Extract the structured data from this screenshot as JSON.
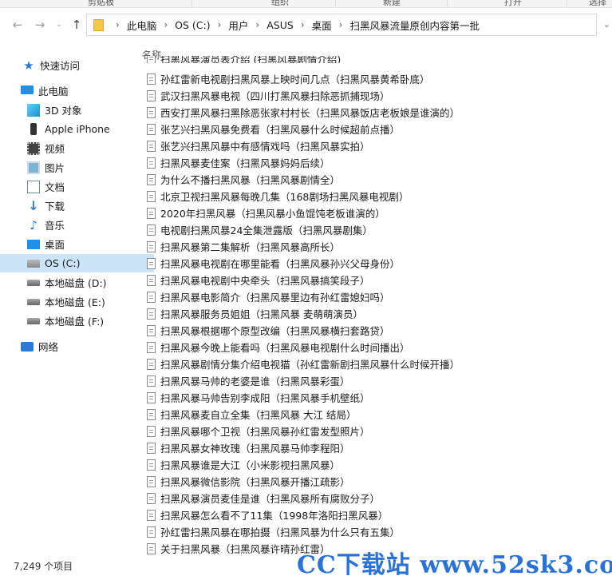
{
  "ribbon": {
    "tabs": [
      "剪贴板",
      "组织",
      "新建",
      "打开",
      "选择"
    ]
  },
  "address_bar": {
    "breadcrumbs": [
      "此电脑",
      "OS (C:)",
      "用户",
      "ASUS",
      "桌面",
      "扫黑风暴流量原创内容第一批"
    ]
  },
  "sidebar": {
    "quick_access": "快速访问",
    "this_pc": "此电脑",
    "items": [
      "3D 对象",
      "Apple iPhone",
      "视频",
      "图片",
      "文档",
      "下载",
      "音乐",
      "桌面",
      "OS (C:)",
      "本地磁盘 (D:)",
      "本地磁盘 (E:)",
      "本地磁盘 (F:)"
    ],
    "network": "网络"
  },
  "list": {
    "column_name": "名称",
    "partial_top": "扫黑风暴演员表介绍 (扫黑风暴剧情介绍)",
    "files": [
      "孙红雷新电视剧扫黑风暴上映时间几点（扫黑风暴黄希卧底）",
      "武汉扫黑风暴电视（四川打黑风暴扫除恶抓捕现场）",
      "西安打黑风暴扫黑除恶张家村村长（扫黑风暴饭店老板娘是谁演的）",
      "张艺兴扫黑风暴免费看（扫黑风暴什么时候超前点播）",
      "张艺兴扫黑风暴中有感情戏吗（扫黑风暴实拍）",
      "扫黑风暴麦佳案（扫黑风暴妈妈后续）",
      "为什么不播扫黑风暴（扫黑风暴剧情全）",
      "北京卫视扫黑风暴每晚几集（168剧场扫黑风暴电视剧）",
      "2020年扫黑风暴（扫黑风暴小鱼馄饨老板谁演的）",
      "电视剧扫黑风暴24全集泄露版（扫黑风暴剧集）",
      "扫黑风暴第二集解析（扫黑风暴高所长）",
      "扫黑风暴电视剧在哪里能看（扫黑风暴孙兴父母身份）",
      "扫黑风暴电视剧中央牵头（扫黑风暴搞笑段子）",
      "扫黑风暴电影简介（扫黑风暴里边有孙红雷媳妇吗）",
      "扫黑风暴服务员姐姐（扫黑风暴 麦萌萌演员）",
      "扫黑风暴根据哪个原型改编（扫黑风暴横扫套路贷）",
      "扫黑风暴今晚上能看吗（扫黑风暴电视剧什么时间播出）",
      "扫黑风暴剧情分集介绍电视猫（孙红雷新剧扫黑风暴什么时候开播）",
      "扫黑风暴马帅的老婆是谁（扫黑风暴彩蛋）",
      "扫黑风暴马帅告别李成阳（扫黑风暴手机壁纸）",
      "扫黑风暴麦自立全集（扫黑风暴 大江 结局）",
      "扫黑风暴哪个卫视（扫黑风暴孙红雷发型照片）",
      "扫黑风暴女神玫瑰（扫黑风暴马帅李程阳）",
      "扫黑风暴谁是大江（小米影视扫黑风暴）",
      "扫黑风暴微信影院（扫黑风暴开播江疏影）",
      "扫黑风暴演员麦佳是谁（扫黑风暴所有腐败分子）",
      "扫黑风暴怎么看不了11集（1998年洛阳扫黑风暴）",
      "孙红雷扫黑风暴在哪拍摄（扫黑风暴为什么只有五集）",
      "关于扫黑风暴（扫黑风暴许晴孙红雷）"
    ]
  },
  "status": {
    "count": "7,249 个项目"
  },
  "watermark": "CC下载站 www.52sk3.com"
}
